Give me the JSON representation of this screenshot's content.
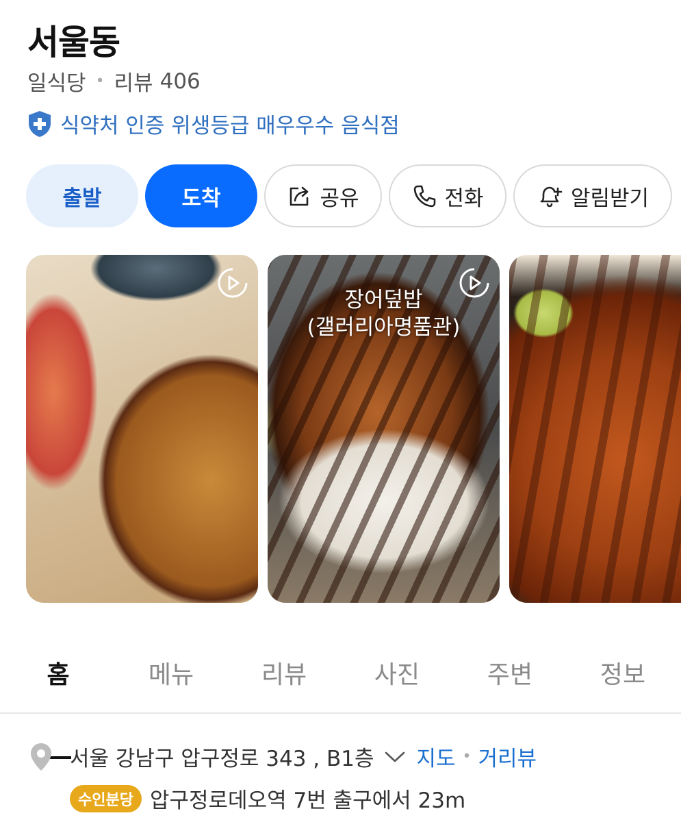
{
  "place": {
    "name": "서울동",
    "category": "일식당",
    "review_label": "리뷰",
    "review_count": "406",
    "certification": "식약처 인증 위생등급 매우우수 음식점"
  },
  "actions": {
    "depart": "출발",
    "arrive": "도착",
    "share": "공유",
    "call": "전화",
    "notify": "알림받기"
  },
  "photos": [
    {
      "caption": "",
      "has_play": true
    },
    {
      "caption_line1": "장어덮밥",
      "caption_line2": "(갤러리아명품관)",
      "has_play": true
    },
    {
      "caption": "",
      "has_play": false
    }
  ],
  "tabs": [
    {
      "label": "홈",
      "active": true
    },
    {
      "label": "메뉴",
      "active": false
    },
    {
      "label": "리뷰",
      "active": false
    },
    {
      "label": "사진",
      "active": false
    },
    {
      "label": "주변",
      "active": false
    },
    {
      "label": "정보",
      "active": false
    }
  ],
  "address": {
    "text": "서울 강남구 압구정로 343 , B1층",
    "map_link": "지도",
    "roadview_link": "거리뷰"
  },
  "subway": {
    "line": "수인분당",
    "line_color": "#e8a81c",
    "directions": "압구정로데오역 7번 출구에서 23m"
  },
  "colors": {
    "primary": "#0a6cff",
    "link": "#1a6fd0",
    "cert": "#2f6fbf"
  }
}
